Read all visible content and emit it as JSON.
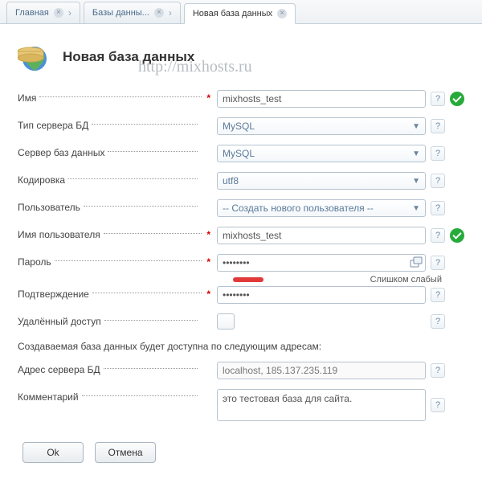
{
  "tabs": [
    {
      "label": "Главная"
    },
    {
      "label": "Базы данны..."
    },
    {
      "label": "Новая база данных"
    }
  ],
  "header": {
    "title": "Новая база данных"
  },
  "watermark": "http://mixhosts.ru",
  "labels": {
    "name": "Имя",
    "server_type": "Тип сервера БД",
    "db_server": "Сервер баз данных",
    "encoding": "Кодировка",
    "user": "Пользователь",
    "username": "Имя пользователя",
    "password": "Пароль",
    "confirm": "Подтверждение",
    "remote": "Удалённый доступ",
    "server_addr": "Адрес сервера БД",
    "comment": "Комментарий"
  },
  "values": {
    "name": "mixhosts_test",
    "server_type": "MySQL",
    "db_server": "MySQL",
    "encoding": "utf8",
    "user": "-- Создать нового пользователя --",
    "username": "mixhosts_test",
    "password": "••••••••",
    "confirm": "••••••••",
    "server_addr": "localhost, 185.137.235.119",
    "comment": "это тестовая база для сайта."
  },
  "password_strength": {
    "label": "Слишком слабый",
    "color": "#e13a3a"
  },
  "note": "Создаваемая база данных будет доступна по следующим адресам:",
  "buttons": {
    "ok": "Ok",
    "cancel": "Отмена"
  }
}
